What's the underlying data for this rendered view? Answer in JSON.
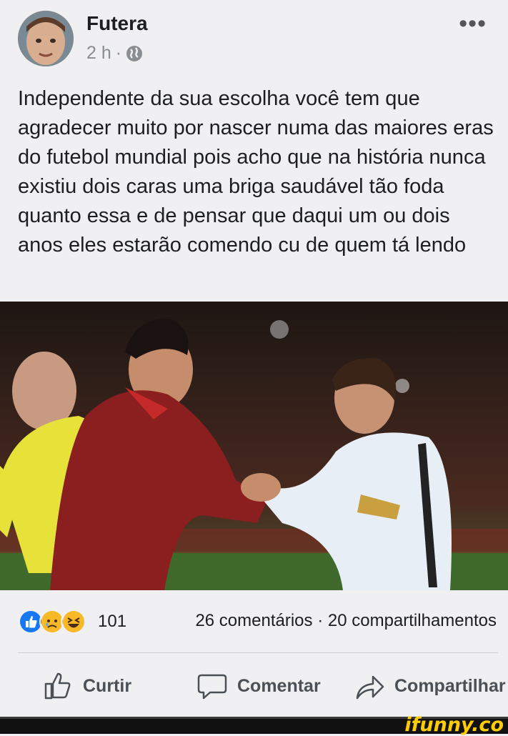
{
  "post": {
    "author": "Futera",
    "time": "2 h",
    "separator": "·",
    "text": "Independente da sua escolha você tem que agradecer muito por nascer numa das maiores eras do futebol mundial pois acho que na história nunca existiu dois caras uma briga saudável tão foda quanto essa e de pensar que daqui um ou dois anos eles estarão comendo cu de quem tá lendo",
    "more_label": "•••"
  },
  "stats": {
    "reaction_count": "101",
    "comments": "26 comentários",
    "separator": "·",
    "shares": "20 compartilhamentos"
  },
  "actions": {
    "like": "Curtir",
    "comment": "Comentar",
    "share": "Compartilhar"
  },
  "watermark": "ifunny.co",
  "colors": {
    "like_blue": "#1877f2",
    "reaction_yellow": "#f7b928",
    "action_gray": "#4b4f56"
  },
  "icons": {
    "globe": "globe-icon",
    "like": "thumbs-up-icon",
    "comment": "speech-bubble-icon",
    "share": "share-arrow-icon"
  }
}
